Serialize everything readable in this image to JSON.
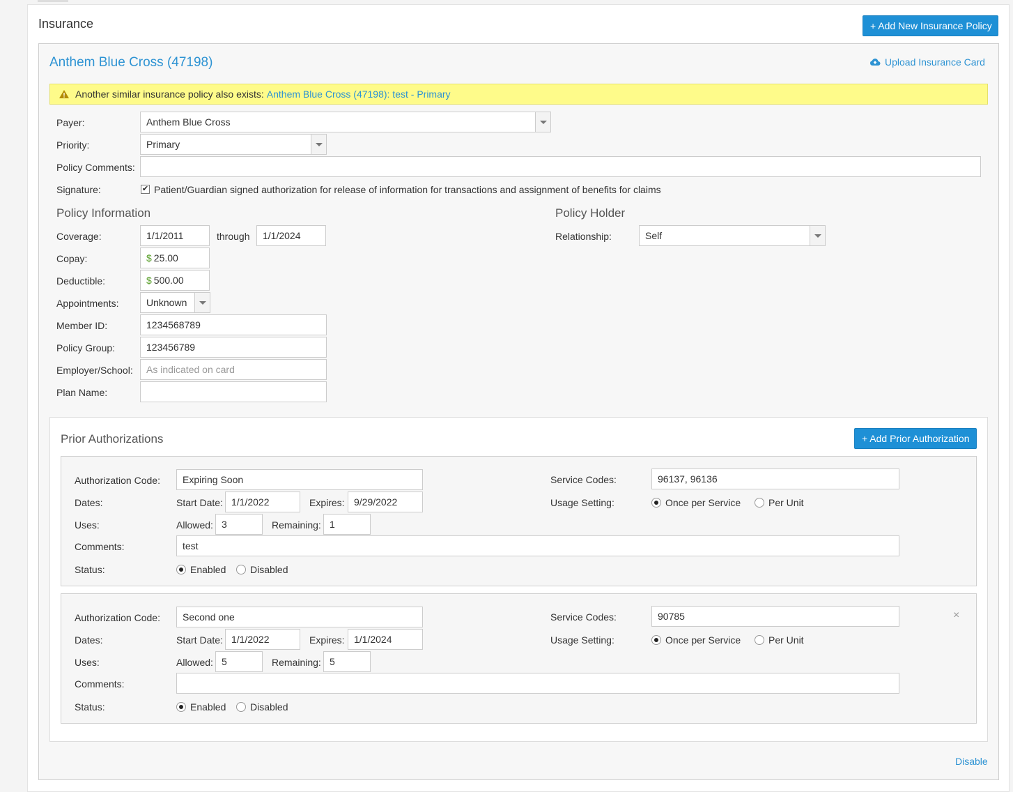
{
  "page_title": "Insurance",
  "add_policy_label": "+ Add New Insurance Policy",
  "policy": {
    "title": "Anthem Blue Cross (47198)",
    "upload_label": "Upload Insurance Card",
    "warning_text": "Another similar insurance policy also exists:",
    "warning_link": "Anthem Blue Cross (47198): test - Primary",
    "labels": {
      "payer": "Payer:",
      "priority": "Priority:",
      "policy_comments": "Policy Comments:",
      "signature": "Signature:",
      "coverage": "Coverage:",
      "through": "through",
      "copay": "Copay:",
      "deductible": "Deductible:",
      "appointments": "Appointments:",
      "member_id": "Member ID:",
      "policy_group": "Policy Group:",
      "employer": "Employer/School:",
      "plan_name": "Plan Name:",
      "relationship": "Relationship:"
    },
    "payer": "Anthem Blue Cross",
    "priority": "Primary",
    "policy_comments": "",
    "signature_text": "Patient/Guardian signed authorization for release of information for transactions and assignment of benefits for claims",
    "signature_checked": "✔",
    "policy_info_title": "Policy Information",
    "coverage_start": "1/1/2011",
    "coverage_end": "1/1/2024",
    "currency_symbol": "$",
    "copay": "25.00",
    "deductible": "500.00",
    "appointments": "Unknown",
    "member_id": "1234568789",
    "policy_group": "123456789",
    "employer_placeholder": "As indicated on card",
    "plan_name": "",
    "policy_holder_title": "Policy Holder",
    "relationship": "Self"
  },
  "prior_auth": {
    "title": "Prior Authorizations",
    "add_label": "+ Add Prior Authorization",
    "labels": {
      "code": "Authorization Code:",
      "dates": "Dates:",
      "start": "Start Date:",
      "expires": "Expires:",
      "uses": "Uses:",
      "allowed": "Allowed:",
      "remaining": "Remaining:",
      "comments": "Comments:",
      "status": "Status:",
      "service_codes": "Service Codes:",
      "usage": "Usage Setting:",
      "once": "Once per Service",
      "per_unit": "Per Unit",
      "enabled": "Enabled",
      "disabled": "Disabled"
    },
    "items": [
      {
        "code": "Expiring Soon",
        "start": "1/1/2022",
        "expires": "9/29/2022",
        "allowed": "3",
        "remaining": "1",
        "comments": "test",
        "service_codes": "96137, 96136"
      },
      {
        "code": "Second one",
        "start": "1/1/2022",
        "expires": "1/1/2024",
        "allowed": "5",
        "remaining": "5",
        "comments": "",
        "service_codes": "90785",
        "close": "×"
      }
    ]
  },
  "disable_label": "Disable",
  "colors": {
    "accent": "#1e90d6",
    "link": "#2e93d3",
    "warning_bg": "#fefb8a"
  }
}
